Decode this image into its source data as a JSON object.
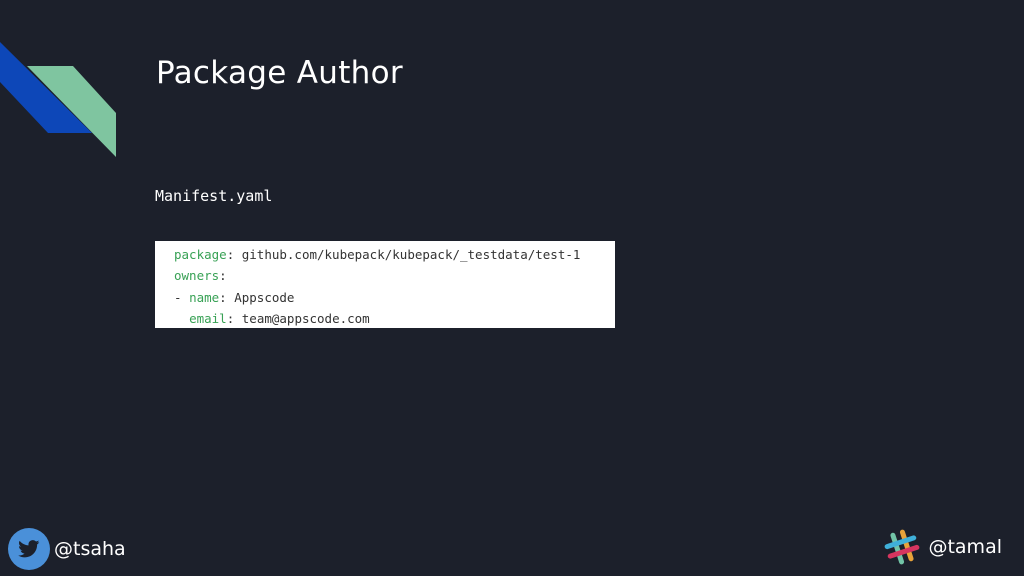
{
  "slide": {
    "title": "Package Author",
    "file_label": "Manifest.yaml"
  },
  "code": {
    "lines": [
      {
        "indent": "",
        "key": "package",
        "sep": ": ",
        "value": "github.com/kubepack/kubepack/_testdata/test-1"
      },
      {
        "indent": "",
        "key": "owners",
        "sep": ":",
        "value": ""
      },
      {
        "indent": "- ",
        "key": "name",
        "sep": ": ",
        "value": "Appscode"
      },
      {
        "indent": "  ",
        "key": "email",
        "sep": ": ",
        "value": "team@appscode.com"
      }
    ]
  },
  "footer": {
    "left_handle": "@tsaha",
    "left_icon": "twitter-icon",
    "right_handle": "@tamal",
    "right_icon": "slack-icon"
  },
  "colors": {
    "background": "#1c202b",
    "accent_blue": "#0d47b8",
    "accent_green": "#7fc5a0",
    "code_key": "#38a155",
    "twitter_blue": "#4a90d9"
  }
}
